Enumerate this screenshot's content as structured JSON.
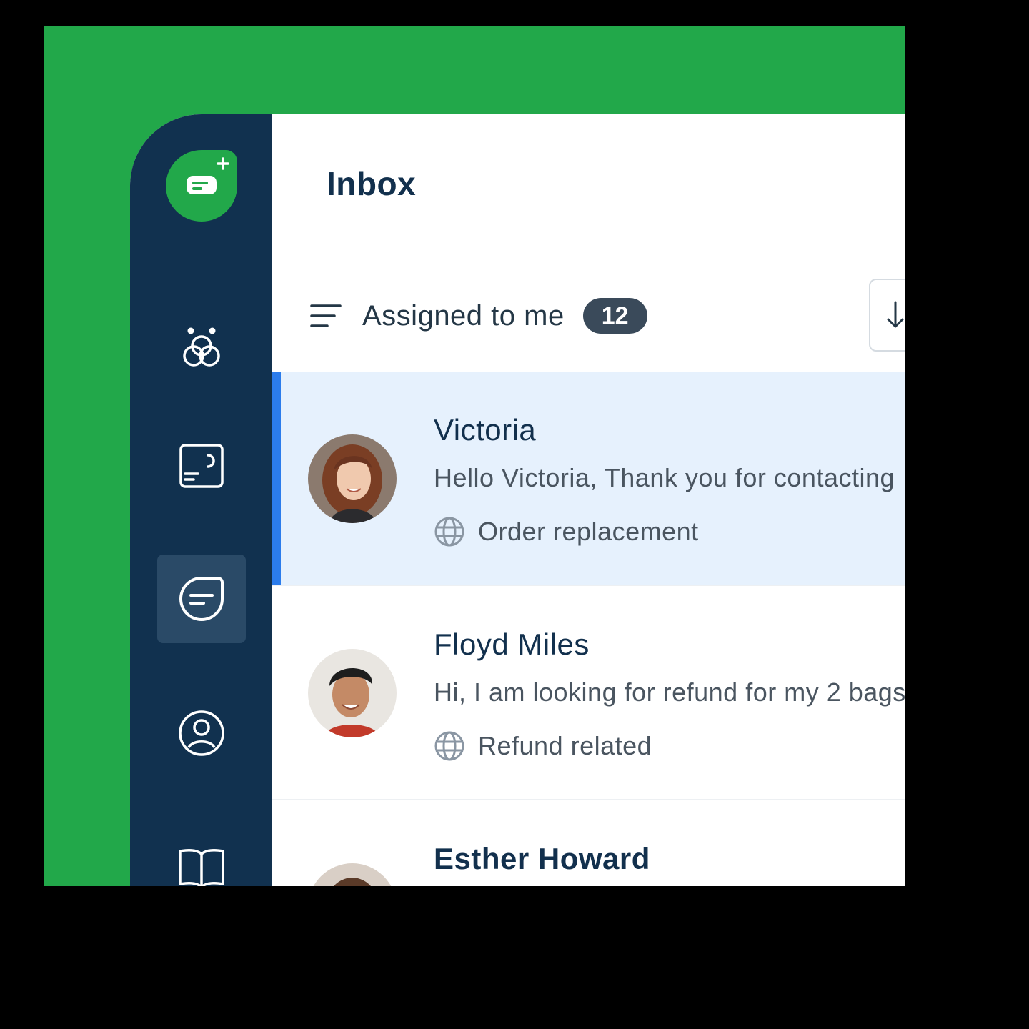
{
  "colors": {
    "brand_green": "#22a84a",
    "sidebar_bg": "#11314f",
    "active_item_bg": "#e6f1fd",
    "accent_blue": "#2b7cec"
  },
  "sidebar": {
    "logo_icon": "chat-plus-icon",
    "items": [
      {
        "icon": "bot-icon",
        "active": false
      },
      {
        "icon": "dashboard-icon",
        "active": false
      },
      {
        "icon": "conversation-icon",
        "active": true
      },
      {
        "icon": "contact-icon",
        "active": false
      },
      {
        "icon": "knowledge-book-icon",
        "active": false
      }
    ]
  },
  "header": {
    "title": "Inbox"
  },
  "filter": {
    "icon": "filter-lines-icon",
    "label": "Assigned to me",
    "count": "12",
    "sort_icon": "arrow-down-icon"
  },
  "conversations": [
    {
      "name": "Victoria",
      "preview": "Hello Victoria, Thank you for contacting",
      "tag": "Order replacement",
      "tag_icon": "globe-icon",
      "active": true
    },
    {
      "name": "Floyd Miles",
      "preview": "Hi, I am looking for refund for my 2 bags",
      "tag": "Refund related",
      "tag_icon": "globe-icon",
      "active": false
    },
    {
      "name": "Esther Howard",
      "unread": true,
      "active": false
    }
  ]
}
